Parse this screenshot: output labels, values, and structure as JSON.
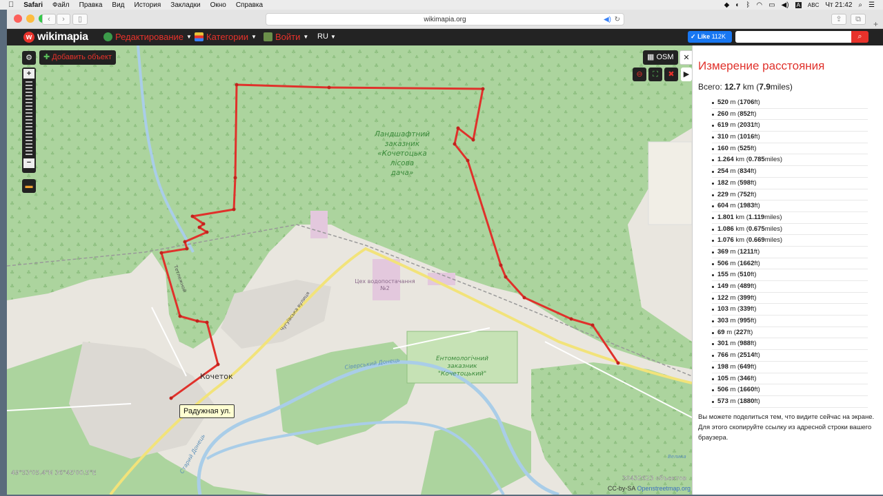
{
  "mac_menubar": {
    "app": "Safari",
    "items": [
      "Файл",
      "Правка",
      "Вид",
      "История",
      "Закладки",
      "Окно",
      "Справка"
    ],
    "input_lang": "ABC",
    "clock": "Чт 21:42"
  },
  "browser": {
    "url": "wikimapia.org"
  },
  "wikimapia": {
    "logo": "wikimapia",
    "menu": [
      {
        "label": "Редактирование",
        "icon": "globe-icon"
      },
      {
        "label": "Категории",
        "icon": "category-icon"
      },
      {
        "label": "Войти",
        "icon": "login-icon"
      }
    ],
    "lang": "RU",
    "fb_like": "Like",
    "fb_count": "112K"
  },
  "map": {
    "add_object": "Добавить объект",
    "layer": "OSM",
    "labels": {
      "reserve1": [
        "Ландшафтний",
        "заказник",
        "«Кочетоцька",
        "лісова",
        "дача»"
      ],
      "water": [
        "Цех водопостачання",
        "№2"
      ],
      "reserve2": [
        "Ентомологічний",
        "заказник",
        "\"Кочетоцький\""
      ],
      "village": "Кочеток",
      "river1": "Сіверський Донець",
      "river2": "Старий Донець",
      "street1": "Чугуївська вулиця",
      "street2": "Тетлежной",
      "velyka": "Велика"
    },
    "tooltip": "Радужная ул.",
    "coords": "49°53'05.4\"N 36°45'00.5\"E",
    "objects": "30432623 объектов",
    "license": "CC-by-SA",
    "license_link": "Openstreetmap.org"
  },
  "panel": {
    "title": "Измерение расстояния",
    "total_label": "Всего:",
    "total_km": "12.7",
    "total_km_unit": "km",
    "total_miles": "7.9",
    "total_miles_unit": "miles",
    "segments": [
      {
        "v": "520",
        "u": "m",
        "v2": "1706",
        "u2": "ft"
      },
      {
        "v": "260",
        "u": "m",
        "v2": "852",
        "u2": "ft"
      },
      {
        "v": "619",
        "u": "m",
        "v2": "2031",
        "u2": "ft"
      },
      {
        "v": "310",
        "u": "m",
        "v2": "1016",
        "u2": "ft"
      },
      {
        "v": "160",
        "u": "m",
        "v2": "525",
        "u2": "ft"
      },
      {
        "v": "1.264",
        "u": "km",
        "v2": "0.785",
        "u2": "miles"
      },
      {
        "v": "254",
        "u": "m",
        "v2": "834",
        "u2": "ft"
      },
      {
        "v": "182",
        "u": "m",
        "v2": "598",
        "u2": "ft"
      },
      {
        "v": "229",
        "u": "m",
        "v2": "752",
        "u2": "ft"
      },
      {
        "v": "604",
        "u": "m",
        "v2": "1983",
        "u2": "ft"
      },
      {
        "v": "1.801",
        "u": "km",
        "v2": "1.119",
        "u2": "miles"
      },
      {
        "v": "1.086",
        "u": "km",
        "v2": "0.675",
        "u2": "miles"
      },
      {
        "v": "1.076",
        "u": "km",
        "v2": "0.669",
        "u2": "miles"
      },
      {
        "v": "369",
        "u": "m",
        "v2": "1211",
        "u2": "ft"
      },
      {
        "v": "506",
        "u": "m",
        "v2": "1662",
        "u2": "ft"
      },
      {
        "v": "155",
        "u": "m",
        "v2": "510",
        "u2": "ft"
      },
      {
        "v": "149",
        "u": "m",
        "v2": "489",
        "u2": "ft"
      },
      {
        "v": "122",
        "u": "m",
        "v2": "399",
        "u2": "ft"
      },
      {
        "v": "103",
        "u": "m",
        "v2": "339",
        "u2": "ft"
      },
      {
        "v": "303",
        "u": "m",
        "v2": "995",
        "u2": "ft"
      },
      {
        "v": "69",
        "u": "m",
        "v2": "227",
        "u2": "ft"
      },
      {
        "v": "301",
        "u": "m",
        "v2": "988",
        "u2": "ft"
      },
      {
        "v": "766",
        "u": "m",
        "v2": "2514",
        "u2": "ft"
      },
      {
        "v": "198",
        "u": "m",
        "v2": "649",
        "u2": "ft"
      },
      {
        "v": "105",
        "u": "m",
        "v2": "346",
        "u2": "ft"
      },
      {
        "v": "506",
        "u": "m",
        "v2": "1660",
        "u2": "ft"
      },
      {
        "v": "573",
        "u": "m",
        "v2": "1880",
        "u2": "ft"
      }
    ],
    "share_text": "Вы можете поделиться тем, что видите сейчас на экране. Для этого скопируйте ссылку из адресной строки вашего браузера."
  },
  "colors": {
    "accent": "#e0312b",
    "forest": "#a9d39b",
    "route": "#e0312b",
    "facebook": "#1877f2"
  }
}
